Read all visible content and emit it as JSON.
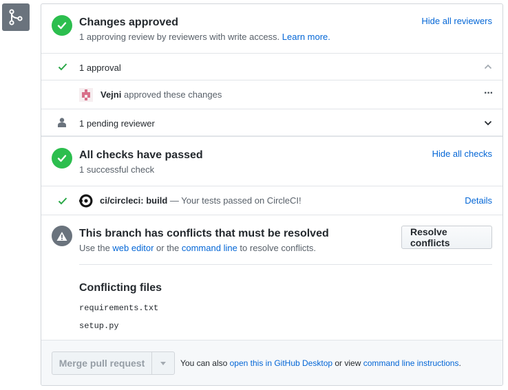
{
  "approved": {
    "title": "Changes approved",
    "subtitle": "1 approving review by reviewers with write access.",
    "learn_more": "Learn more.",
    "hide_link": "Hide all reviewers"
  },
  "approval_row": {
    "label": "1 approval"
  },
  "reviewer_row": {
    "name": "Vejni",
    "action": "approved these changes",
    "menu": "···"
  },
  "pending_row": {
    "label": "1 pending reviewer"
  },
  "checks": {
    "title": "All checks have passed",
    "subtitle": "1 successful check",
    "hide_link": "Hide all checks"
  },
  "check_row": {
    "name": "ci/circleci: build",
    "description": " — Your tests passed on CircleCI!",
    "details": "Details"
  },
  "conflicts": {
    "title": "This branch has conflicts that must be resolved",
    "use_the": "Use the ",
    "web_editor": "web editor",
    "or_the": " or the ",
    "command_line": "command line",
    "to_resolve": " to resolve conflicts.",
    "resolve_button": "Resolve conflicts",
    "files_heading": "Conflicting files",
    "files": [
      "requirements.txt",
      "setup.py"
    ]
  },
  "footer": {
    "merge_button": "Merge pull request",
    "you_can_also": "You can also ",
    "desktop_link": "open this in GitHub Desktop",
    "or_view": " or view ",
    "cli_link": "command line instructions",
    "period": "."
  },
  "colors": {
    "success": "#2cbe4e",
    "link": "#0366d6",
    "muted": "#586069",
    "neutral": "#6a737d"
  },
  "icons": {
    "badge": "git-merge-icon",
    "approved": "check-circle-icon",
    "approval_row": "check-icon",
    "avatar": "identicon-avatar",
    "pending": "person-icon",
    "conflict": "alert-icon",
    "check_status": "check-icon",
    "circleci": "circleci-logo-icon"
  }
}
